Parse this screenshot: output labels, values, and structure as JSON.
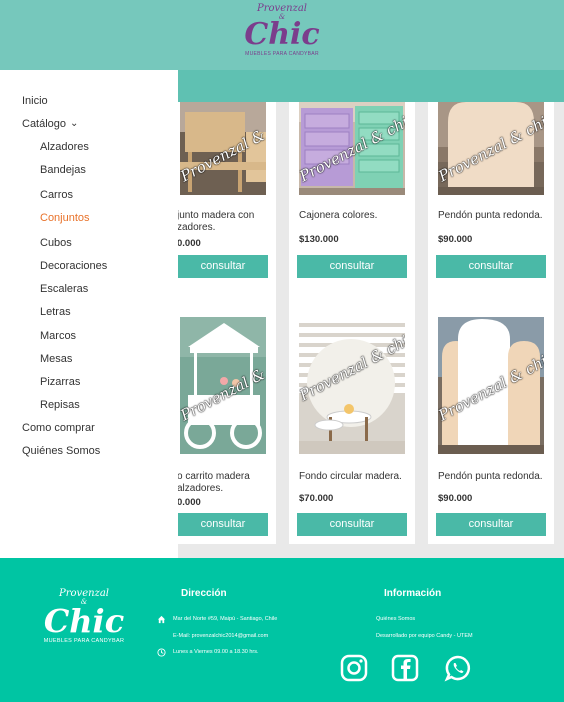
{
  "header": {
    "logo": {
      "top": "Provenzal",
      "amp": "&",
      "main": "Chic",
      "sub": "MUEBLES PARA CANDYBAR"
    }
  },
  "sidebar": {
    "items": [
      {
        "label": "Inicio",
        "level": 0
      },
      {
        "label": "Catálogo",
        "level": 0,
        "chevron": "chevron-down-icon"
      },
      {
        "label": "Alzadores",
        "level": 1
      },
      {
        "label": "Bandejas",
        "level": 1
      },
      {
        "label": "Carros",
        "level": 1
      },
      {
        "label": "Conjuntos",
        "level": 1,
        "active": true
      },
      {
        "label": "Cubos",
        "level": 1
      },
      {
        "label": "Decoraciones",
        "level": 1
      },
      {
        "label": "Escaleras",
        "level": 1
      },
      {
        "label": "Letras",
        "level": 1
      },
      {
        "label": "Marcos",
        "level": 1
      },
      {
        "label": "Mesas",
        "level": 1
      },
      {
        "label": "Pizarras",
        "level": 1
      },
      {
        "label": "Repisas",
        "level": 1
      },
      {
        "label": "Como comprar",
        "level": 0
      },
      {
        "label": "Quiénes Somos",
        "level": 0
      }
    ],
    "active_color": "#e8722a"
  },
  "products": [
    {
      "name": "junto madera con\nzadores.",
      "price": "0.000",
      "button": "consultar",
      "watermark": "Provenzal & chic"
    },
    {
      "name": "Cajonera colores.",
      "price": "$130.000",
      "button": "consultar",
      "watermark": "Provenzal & chic"
    },
    {
      "name": "Pendón punta redonda.",
      "price": "$90.000",
      "button": "consultar",
      "watermark": "Provenzal & chic"
    },
    {
      "name": "o carrito madera\nalzadores.",
      "price": "0.000",
      "button": "consultar",
      "watermark": "Provenzal & chic"
    },
    {
      "name": "Fondo circular madera.",
      "price": "$70.000",
      "button": "consultar",
      "watermark": "Provenzal & chic"
    },
    {
      "name": "Pendón punta redonda.",
      "price": "$90.000",
      "button": "consultar",
      "watermark": "Provenzal & chic"
    }
  ],
  "footer": {
    "logo": {
      "top": "Provenzal",
      "amp": "&",
      "main": "Chic",
      "sub": "MUEBLES PARA CANDYBAR"
    },
    "direccion": {
      "title": "Dirección",
      "address": "Mar del Norte #59, Maipú - Santiago, Chile",
      "email": "E-Mail: provenzalchic2014@gmail.com",
      "hours": "Lunes a Viernes 09.00 a 18.30 hrs."
    },
    "informacion": {
      "title": "Información",
      "link": "Quiénes Somos",
      "credit": "Desarrollado por equipo Candy - UTEM"
    },
    "social": [
      "instagram-icon",
      "facebook-icon",
      "whatsapp-icon"
    ]
  },
  "colors": {
    "header": "#76c8bc",
    "band": "#5fc1b2",
    "button": "#4ab9a7",
    "footer": "#00c5a3",
    "brand": "#7b3d8c"
  }
}
